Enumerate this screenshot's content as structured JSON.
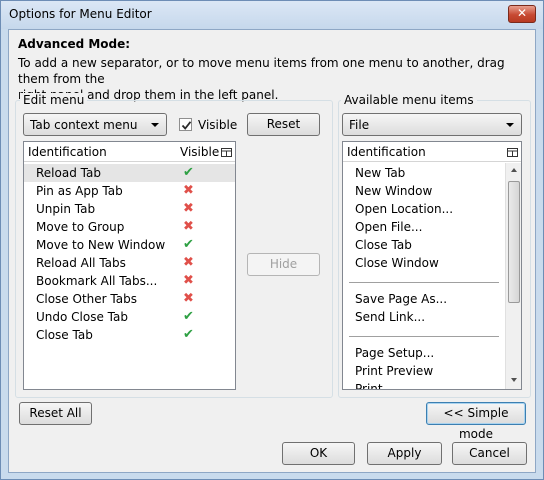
{
  "window": {
    "title": "Options for Menu Editor",
    "close_glyph": "✕"
  },
  "heading": "Advanced Mode:",
  "description_line1": "To add a new separator, or to move menu items from one menu to another, drag them from the",
  "description_line2": "right panel and drop them in the left panel.",
  "edit_menu": {
    "label": "Edit menu",
    "dropdown_value": "Tab context menu",
    "visible_label": "Visible",
    "visible_checked": true,
    "reset_label": "Reset",
    "col_identification": "Identification",
    "col_visible": "Visible",
    "items": [
      {
        "name": "Reload Tab",
        "visible": true,
        "mark": "✔"
      },
      {
        "name": "Pin as App Tab",
        "visible": false,
        "mark": "✖"
      },
      {
        "name": "Unpin Tab",
        "visible": false,
        "mark": "✖"
      },
      {
        "name": "Move to Group",
        "visible": false,
        "mark": "✖"
      },
      {
        "name": "Move to New Window",
        "visible": true,
        "mark": "✔"
      },
      {
        "name": "Reload All Tabs",
        "visible": false,
        "mark": "✖"
      },
      {
        "name": "Bookmark All Tabs...",
        "visible": false,
        "mark": "✖"
      },
      {
        "name": "Close Other Tabs",
        "visible": false,
        "mark": "✖"
      },
      {
        "name": "Undo Close Tab",
        "visible": true,
        "mark": "✔"
      },
      {
        "name": "Close Tab",
        "visible": true,
        "mark": "✔"
      }
    ]
  },
  "hide_label": "Hide",
  "available": {
    "label": "Available menu items",
    "dropdown_value": "File",
    "col_identification": "Identification",
    "items": [
      "New Tab",
      "New Window",
      "Open Location...",
      "Open File...",
      "Close Tab",
      "Close Window",
      "Save Page As...",
      "Send Link...",
      "Page Setup...",
      "Print Preview",
      "Print..."
    ]
  },
  "reset_all_label": "Reset All",
  "simple_mode_label": "<< Simple mode",
  "ok_label": "OK",
  "apply_label": "Apply",
  "cancel_label": "Cancel",
  "colors": {
    "check_green": "#2ea043",
    "cross_red": "#e0504a",
    "focus_blue": "#3c7fb1"
  }
}
